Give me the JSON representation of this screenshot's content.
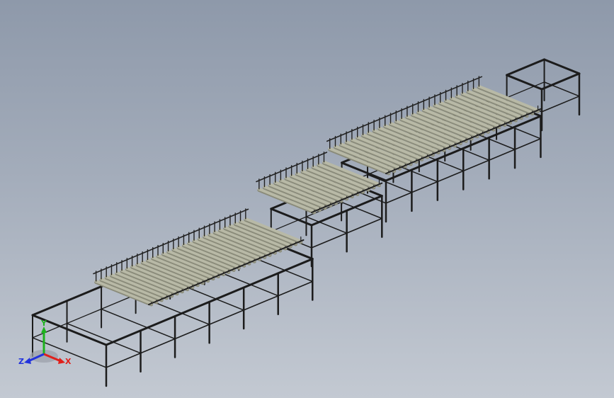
{
  "scene": {
    "description_visible": false,
    "colors": {
      "background_top": "#8e99aa",
      "background_bottom": "#c3c9d2",
      "frame": "#1c1c1c",
      "roller": "#b8b9a6",
      "roller_shadow": "#8a8b7a",
      "bracket": "#222222"
    }
  },
  "triad": {
    "x_label": "X",
    "y_label": "Y",
    "z_label": "Z",
    "x_color": "#e0201b",
    "y_color": "#1db31d",
    "z_color": "#2233dd"
  }
}
